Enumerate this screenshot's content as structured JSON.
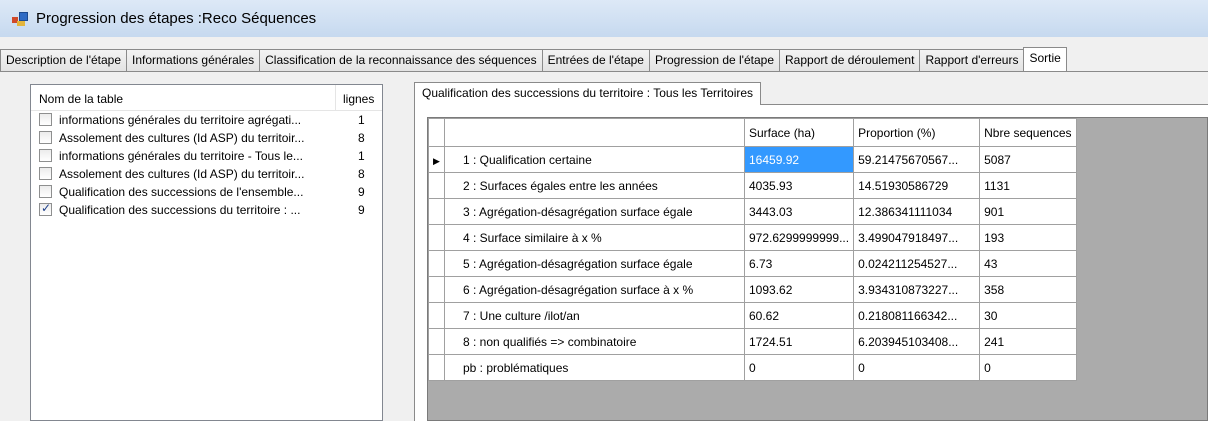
{
  "window": {
    "title": "Progression des étapes :Reco Séquences"
  },
  "tabs": [
    {
      "label": "Description de l'étape"
    },
    {
      "label": "Informations générales"
    },
    {
      "label": "Classification de la reconnaissance des séquences"
    },
    {
      "label": "Entrées de l'étape"
    },
    {
      "label": "Progression de l'étape"
    },
    {
      "label": "Rapport de déroulement"
    },
    {
      "label": "Rapport d'erreurs"
    },
    {
      "label": "Sortie"
    }
  ],
  "left_list": {
    "headers": {
      "name": "Nom de la table",
      "rows": "lignes"
    },
    "items": [
      {
        "label": "informations générales du territoire  agrégati...",
        "count": "1",
        "checked": false
      },
      {
        "label": "Assolement des cultures (Id ASP) du territoir...",
        "count": "8",
        "checked": false
      },
      {
        "label": "informations générales du territoire - Tous le...",
        "count": "1",
        "checked": false
      },
      {
        "label": "Assolement des cultures (Id ASP) du territoir...",
        "count": "8",
        "checked": false
      },
      {
        "label": "Qualification des successions de l'ensemble...",
        "count": "9",
        "checked": false
      },
      {
        "label": "Qualification des successions du territoire : ...",
        "count": "9",
        "checked": true
      }
    ]
  },
  "inner_tab": {
    "label": "Qualification des successions du territoire : Tous les Territoires"
  },
  "grid": {
    "columns": [
      "Surface (ha)",
      "Proportion (%)",
      "Nbre sequences"
    ],
    "rows": [
      {
        "name": "1 : Qualification certaine",
        "surface": "16459.92",
        "proportion": "59.21475670567...",
        "nbre": "5087"
      },
      {
        "name": "2 : Surfaces égales entre les années",
        "surface": "4035.93",
        "proportion": "14.51930586729",
        "nbre": "1131"
      },
      {
        "name": "3 : Agrégation-désagrégation surface égale",
        "surface": "3443.03",
        "proportion": "12.386341111034",
        "nbre": "901"
      },
      {
        "name": "4 : Surface similaire à x %",
        "surface": "972.6299999999...",
        "proportion": "3.499047918497...",
        "nbre": "193"
      },
      {
        "name": "5 : Agrégation-désagrégation surface égale",
        "surface": "6.73",
        "proportion": "0.024211254527...",
        "nbre": "43"
      },
      {
        "name": "6 : Agrégation-désagrégation surface à x %",
        "surface": "1093.62",
        "proportion": "3.934310873227...",
        "nbre": "358"
      },
      {
        "name": "7 : Une culture /ilot/an",
        "surface": "60.62",
        "proportion": "0.218081166342...",
        "nbre": "30"
      },
      {
        "name": "8 : non qualifiés => combinatoire",
        "surface": "1724.51",
        "proportion": "6.203945103408...",
        "nbre": "241"
      },
      {
        "name": "pb : problématiques",
        "surface": "0",
        "proportion": "0",
        "nbre": "0"
      }
    ],
    "current_row_icon": "row-pointer-icon"
  },
  "colors": {
    "title_bar": "#c6d9ef",
    "selection": "#3399ff",
    "grid_background": "#ababab"
  }
}
